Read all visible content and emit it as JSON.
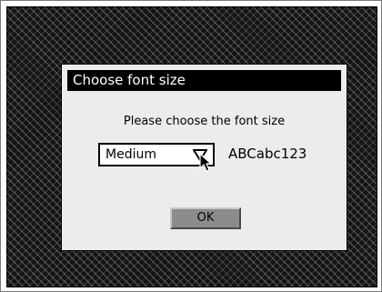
{
  "dialog": {
    "title": "Choose font size",
    "prompt": "Please choose the font size",
    "font_size_select": {
      "selected": "Medium",
      "arrow_icon": "triangle-down-icon"
    },
    "preview_text": "ABCabc123",
    "ok_label": "OK"
  },
  "cursor_icon": "arrow-pointer-icon",
  "colors": {
    "titlebar": "#000000",
    "dialog_background": "#ececec",
    "button": "#8c8c8c"
  }
}
